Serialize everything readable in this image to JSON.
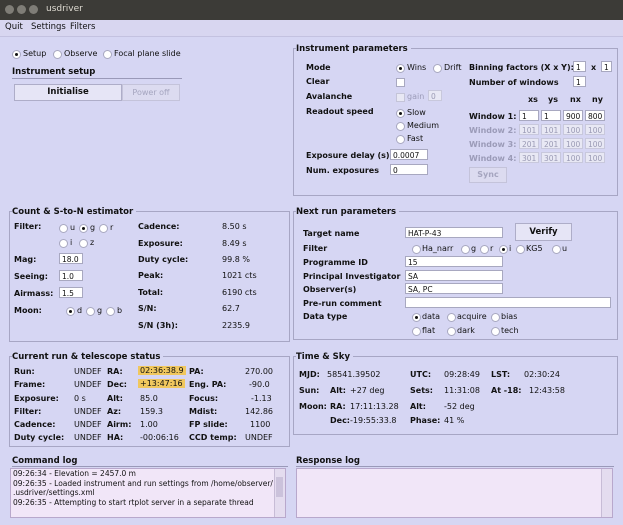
{
  "window": {
    "title": "usdriver"
  },
  "menu": [
    "Quit",
    "Settings",
    "Filters"
  ],
  "mode_radios": [
    {
      "label": "Setup",
      "selected": true
    },
    {
      "label": "Observe",
      "selected": false
    },
    {
      "label": "Focal plane slide",
      "selected": false
    }
  ],
  "instrument_setup": {
    "title": "Instrument setup",
    "initialise": "Initialise",
    "power_off": "Power off"
  },
  "instrument_params": {
    "title": "Instrument parameters",
    "mode_label": "Mode",
    "mode_options": [
      "Wins",
      "Drift"
    ],
    "clear_label": "Clear",
    "avalanche_label": "Avalanche",
    "gain_label": "gain",
    "gain_value": "0",
    "readout_label": "Readout speed",
    "readout_options": [
      "Slow",
      "Medium",
      "Fast"
    ],
    "exposure_delay_label": "Exposure delay (s)",
    "exposure_delay_value": "0.0007",
    "num_exposures_label": "Num. exposures",
    "num_exposures_value": "0",
    "binning_label": "Binning factors (X x Y):",
    "bin_x": "1",
    "bin_times": "x",
    "bin_y": "1",
    "num_windows_label": "Number of windows",
    "num_windows_value": "1",
    "window_headers": [
      "xs",
      "ys",
      "nx",
      "ny"
    ],
    "windows": [
      {
        "label": "Window 1:",
        "values": [
          "1",
          "1",
          "900",
          "800"
        ]
      },
      {
        "label": "Window 2:",
        "values": [
          "101",
          "101",
          "100",
          "100"
        ]
      },
      {
        "label": "Window 3:",
        "values": [
          "201",
          "201",
          "100",
          "100"
        ]
      },
      {
        "label": "Window 4:",
        "values": [
          "301",
          "301",
          "100",
          "100"
        ]
      }
    ],
    "sync": "Sync"
  },
  "count_estimator": {
    "title": "Count & S-to-N estimator",
    "filter_label": "Filter:",
    "filters": [
      "u",
      "g",
      "r",
      "i",
      "z"
    ],
    "mag_label": "Mag:",
    "mag_value": "18.0",
    "seeing_label": "Seeing:",
    "seeing_value": "1.0",
    "airmass_label": "Airmass:",
    "airmass_value": "1.5",
    "moon_label": "Moon:",
    "moon_options": [
      "d",
      "g",
      "b"
    ],
    "stats": [
      {
        "label": "Cadence:",
        "value": "8.50 s"
      },
      {
        "label": "Exposure:",
        "value": "8.49 s"
      },
      {
        "label": "Duty cycle:",
        "value": "99.8 %"
      },
      {
        "label": "Peak:",
        "value": "1021 cts"
      },
      {
        "label": "Total:",
        "value": "6190 cts"
      },
      {
        "label": "S/N:",
        "value": "62.7"
      },
      {
        "label": "S/N (3h):",
        "value": "2235.9"
      }
    ]
  },
  "next_run": {
    "title": "Next run parameters",
    "target_label": "Target name",
    "target_value": "HAT-P-43",
    "verify": "Verify",
    "filter_label": "Filter",
    "filters": [
      "Ha_narr",
      "g",
      "r",
      "i",
      "KG5",
      "u"
    ],
    "programme_label": "Programme ID",
    "programme_value": "15",
    "pi_label": "Principal Investigator",
    "pi_value": "SA",
    "observers_label": "Observer(s)",
    "observers_value": "SA, PC",
    "comment_label": "Pre-run comment",
    "comment_value": "",
    "datatype_label": "Data type",
    "datatypes": [
      "data",
      "acquire",
      "bias",
      "flat",
      "dark",
      "tech"
    ]
  },
  "status": {
    "title": "Current run & telescope status",
    "col1": [
      {
        "label": "Run:",
        "value": "UNDEF"
      },
      {
        "label": "Frame:",
        "value": "UNDEF"
      },
      {
        "label": "Exposure:",
        "value": "0 s"
      },
      {
        "label": "Filter:",
        "value": "UNDEF"
      },
      {
        "label": "Cadence:",
        "value": "UNDEF"
      },
      {
        "label": "Duty cycle:",
        "value": "UNDEF"
      }
    ],
    "col2": [
      {
        "label": "RA:",
        "value": "02:36:38.9"
      },
      {
        "label": "Dec:",
        "value": "+13:47:16"
      },
      {
        "label": "Alt:",
        "value": "85.0"
      },
      {
        "label": "Az:",
        "value": "159.3"
      },
      {
        "label": "Airm:",
        "value": "1.00"
      },
      {
        "label": "HA:",
        "value": "-00:06:16"
      }
    ],
    "col3": [
      {
        "label": "PA:",
        "value": "270.00"
      },
      {
        "label": "Eng. PA:",
        "value": "-90.0"
      },
      {
        "label": "Focus:",
        "value": "-1.13"
      },
      {
        "label": "Mdist:",
        "value": "142.86"
      },
      {
        "label": "FP slide:",
        "value": "1100"
      },
      {
        "label": "CCD temp:",
        "value": "UNDEF"
      }
    ],
    "highlight_color": "#f0c75e"
  },
  "time_sky": {
    "title": "Time & Sky",
    "mjd_label": "MJD:",
    "mjd_value": "58541.39502",
    "utc_label": "UTC:",
    "utc_value": "09:28:49",
    "lst_label": "LST:",
    "lst_value": "02:30:24",
    "sun_label": "Sun:",
    "sun_alt_label": "Alt:",
    "sun_alt_value": "+27 deg",
    "sets_label": "Sets:",
    "sets_value": "11:31:08",
    "at18_label": "At -18:",
    "at18_value": "12:43:58",
    "moon_label": "Moon:",
    "moon_ra_label": "RA:",
    "moon_ra_value": "17:11:13.28",
    "moon_alt_label": "Alt:",
    "moon_alt_value": "-52 deg",
    "moon_dec_label": "Dec:",
    "moon_dec_value": "-19:55:33.8",
    "phase_label": "Phase:",
    "phase_value": "41 %"
  },
  "command_log": {
    "title": "Command log",
    "lines": [
      "09:26:34 - Elevation = 2457.0 m",
      "09:26:35 - Loaded instrument and run settings from /home/observer/",
      ".usdriver/settings.xml",
      "09:26:35 - Attempting to start rtplot server in a separate thread"
    ]
  },
  "response_log": {
    "title": "Response log",
    "lines": []
  }
}
